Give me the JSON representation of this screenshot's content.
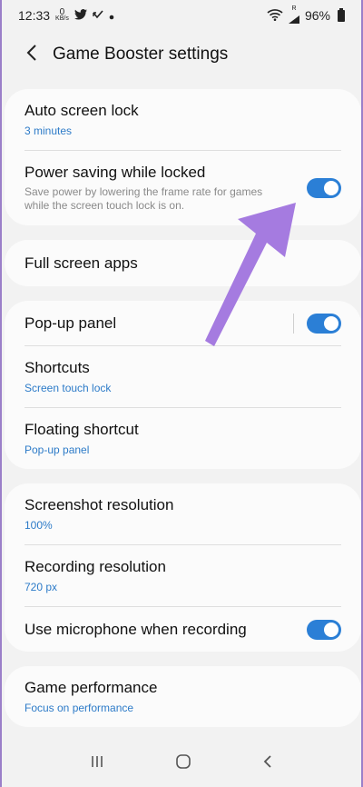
{
  "status_bar": {
    "time": "12:33",
    "net_speed_value": "0",
    "net_speed_unit": "KB/s",
    "signal_tag": "R",
    "battery": "96%"
  },
  "header": {
    "title": "Game Booster settings"
  },
  "sections": {
    "lock": {
      "auto_screen_lock": {
        "label": "Auto screen lock",
        "value": "3 minutes"
      },
      "power_saving": {
        "label": "Power saving while locked",
        "description": "Save power by lowering the frame rate for games while the screen touch lock is on.",
        "enabled": true
      }
    },
    "apps": {
      "full_screen_apps": {
        "label": "Full screen apps"
      }
    },
    "panel": {
      "popup_panel": {
        "label": "Pop-up panel",
        "enabled": true
      },
      "shortcuts": {
        "label": "Shortcuts",
        "value": "Screen touch lock"
      },
      "floating_shortcut": {
        "label": "Floating shortcut",
        "value": "Pop-up panel"
      }
    },
    "recording": {
      "screenshot_resolution": {
        "label": "Screenshot resolution",
        "value": "100%"
      },
      "recording_resolution": {
        "label": "Recording resolution",
        "value": "720 px"
      },
      "use_microphone": {
        "label": "Use microphone when recording",
        "enabled": true
      }
    },
    "performance": {
      "game_performance": {
        "label": "Game performance",
        "value": "Focus on performance"
      }
    }
  },
  "colors": {
    "accent": "#2b7fd6",
    "annotation_arrow": "#a57be0",
    "background": "#f2f2f2",
    "card": "#fbfbfb"
  },
  "icons": {
    "back": "back-arrow-icon",
    "recents": "recents-icon",
    "home": "home-icon",
    "nav_back": "nav-back-icon"
  }
}
